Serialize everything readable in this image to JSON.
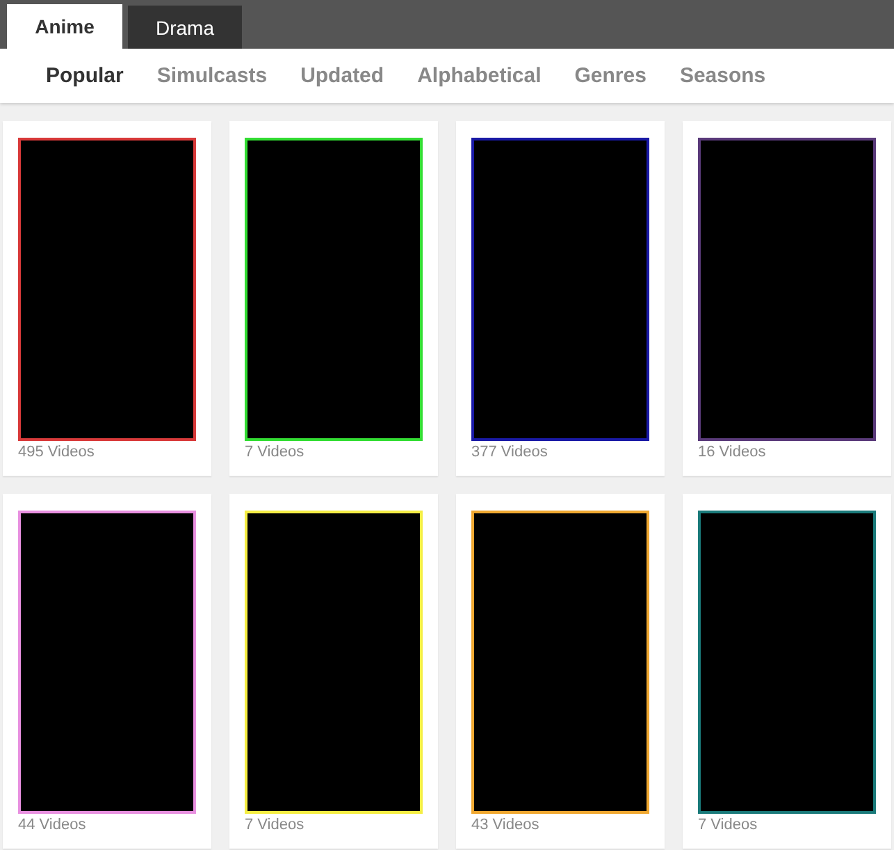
{
  "tabs": [
    {
      "label": "Anime",
      "selected": true
    },
    {
      "label": "Drama",
      "selected": false
    }
  ],
  "subnav": [
    {
      "label": "Popular",
      "selected": true
    },
    {
      "label": "Simulcasts",
      "selected": false
    },
    {
      "label": "Updated",
      "selected": false
    },
    {
      "label": "Alphabetical",
      "selected": false
    },
    {
      "label": "Genres",
      "selected": false
    },
    {
      "label": "Seasons",
      "selected": false
    }
  ],
  "series": [
    {
      "count": "495 Videos",
      "color": "#d93a3a"
    },
    {
      "count": "7 Videos",
      "color": "#33dd33"
    },
    {
      "count": "377 Videos",
      "color": "#1a1aa6"
    },
    {
      "count": "16 Videos",
      "color": "#5a3a7a"
    },
    {
      "count": "44 Videos",
      "color": "#e890e0"
    },
    {
      "count": "7 Videos",
      "color": "#f5ee44"
    },
    {
      "count": "43 Videos",
      "color": "#f0a830"
    },
    {
      "count": "7 Videos",
      "color": "#1a7a7a"
    }
  ]
}
